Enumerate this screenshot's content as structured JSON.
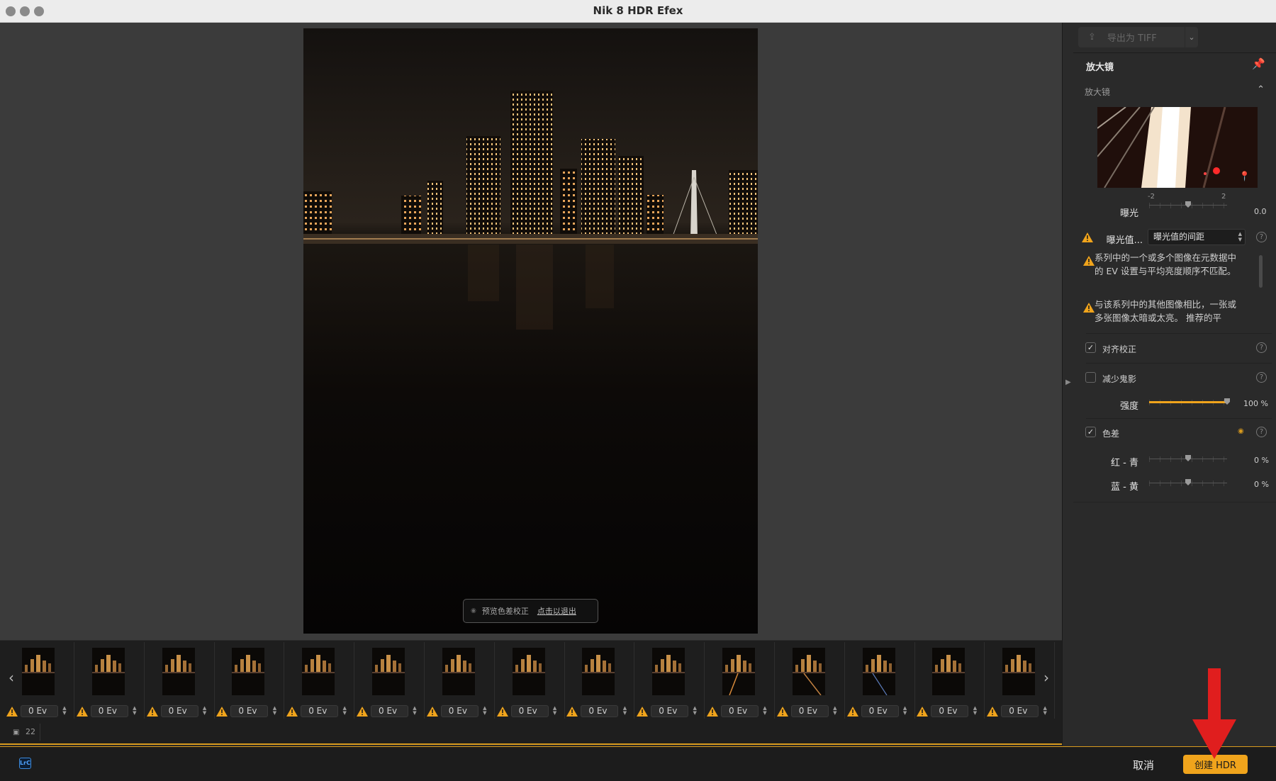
{
  "window": {
    "title": "Nik 8 HDR Efex"
  },
  "preview": {
    "pill_text": "预览色差校正",
    "pill_exit": "点击以退出"
  },
  "filmstrip": {
    "thumbnails": [
      {
        "ev": "0 Ev"
      },
      {
        "ev": "0 Ev"
      },
      {
        "ev": "0 Ev"
      },
      {
        "ev": "0 Ev"
      },
      {
        "ev": "0 Ev"
      },
      {
        "ev": "0 Ev"
      },
      {
        "ev": "0 Ev"
      },
      {
        "ev": "0 Ev"
      },
      {
        "ev": "0 Ev"
      },
      {
        "ev": "0 Ev"
      },
      {
        "ev": "0 Ev"
      },
      {
        "ev": "0 Ev"
      },
      {
        "ev": "0 Ev"
      },
      {
        "ev": "0 Ev"
      },
      {
        "ev": "0 Ev"
      }
    ],
    "image_count": "22"
  },
  "sidebar": {
    "export_label": "导出为 TIFF",
    "loupe_panel_title": "放大镜",
    "loupe_sub_title": "放大镜",
    "exposure": {
      "label": "曝光",
      "min_tick": "-2",
      "max_tick": "2",
      "value": "0.0",
      "level": 0.5
    },
    "ev_spacing": {
      "label": "曝光值...",
      "selected": "曝光值的间距"
    },
    "messages": [
      "系列中的一个或多个图像在元数据中的 EV 设置与平均亮度顺序不匹配。",
      "与该系列中的其他图像相比，一张或多张图像太暗或太亮。 推荐的平"
    ],
    "align": {
      "label": "对齐校正",
      "checked": true
    },
    "ghost": {
      "label": "减少鬼影",
      "checked": false
    },
    "strength": {
      "label": "强度",
      "value": "100 %",
      "level": 1.0
    },
    "chromatic": {
      "label": "色差",
      "checked": true
    },
    "red_cyan": {
      "label": "红 - 青",
      "value": "0 %",
      "level": 0.5
    },
    "blue_yellow": {
      "label": "蓝 - 黄",
      "value": "0 %",
      "level": 0.5
    }
  },
  "bottombar": {
    "lrc": "LrC",
    "cancel_label": "取消",
    "create_label": "创建 HDR"
  },
  "colors": {
    "accent": "#f0a41c",
    "annotation_arrow": "#e01e1e",
    "warning": "#f0a41c"
  }
}
